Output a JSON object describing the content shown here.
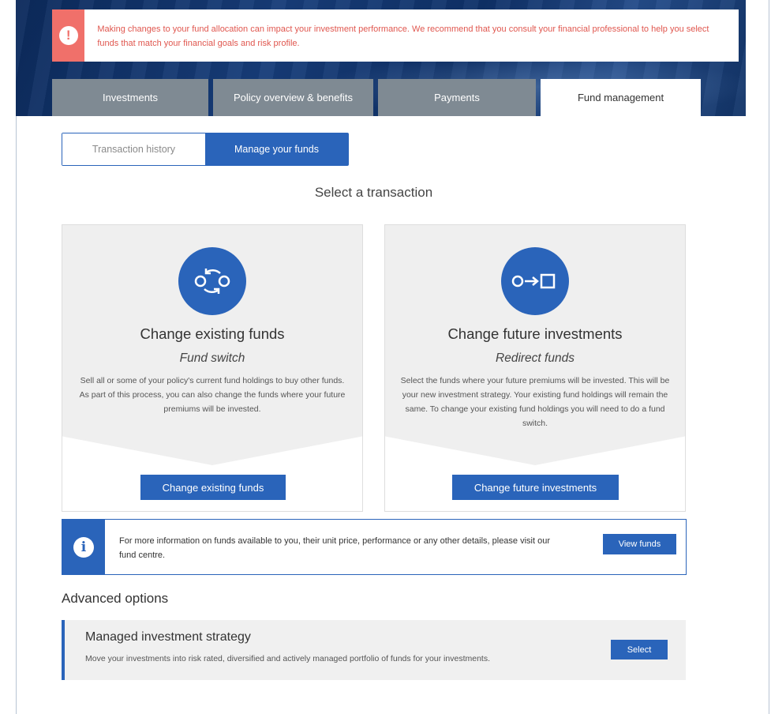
{
  "alert": {
    "icon": "exclamation-icon",
    "text": "Making changes to your fund allocation can impact your investment performance. We recommend that you consult your financial professional to help you select funds that match your financial goals and risk profile."
  },
  "tabs": [
    {
      "label": "Investments",
      "active": false
    },
    {
      "label": "Policy overview & benefits",
      "active": false
    },
    {
      "label": "Payments",
      "active": false
    },
    {
      "label": "Fund management",
      "active": true
    }
  ],
  "subnav": {
    "transaction_history": "Transaction history",
    "manage_funds": "Manage your funds"
  },
  "section_title": "Select a transaction",
  "cards": [
    {
      "icon": "switch-arrows-icon",
      "title": "Change existing funds",
      "subtitle": "Fund switch",
      "description": "Sell all or some of your policy's current fund holdings to buy other funds. As part of this process, you can also change the funds where your future premiums will be invested.",
      "button": "Change existing funds"
    },
    {
      "icon": "redirect-icon",
      "title": "Change future investments",
      "subtitle": "Redirect funds",
      "description": "Select the funds where your future premiums will be invested. This will be your new investment strategy. Your existing fund holdings will remain the same. To change your existing fund holdings you will need to do a fund switch.",
      "button": "Change future investments"
    }
  ],
  "info": {
    "icon": "info-icon",
    "text": "For more information on funds available to you, their unit price, performance or any other details, please visit our fund centre.",
    "button": "View funds"
  },
  "advanced": {
    "title": "Advanced options",
    "item_title": "Managed investment strategy",
    "item_desc": "Move your investments into risk rated, diversified and actively managed portfolio of funds for your investments.",
    "button": "Select"
  },
  "colors": {
    "primary": "#2a64ba",
    "alert": "#f0706a",
    "tab_inactive": "#7f8a93"
  }
}
